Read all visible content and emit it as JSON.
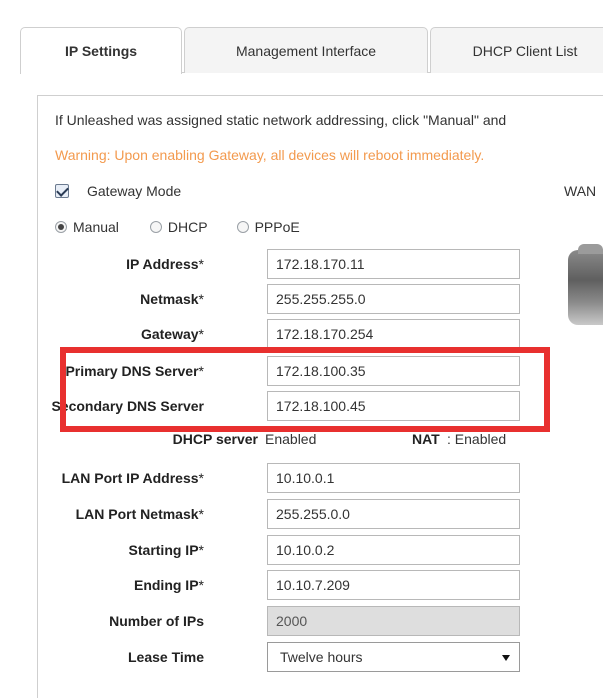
{
  "tabs": [
    {
      "label": "IP Settings",
      "active": true
    },
    {
      "label": "Management Interface",
      "active": false
    },
    {
      "label": "DHCP Client List",
      "active": false
    }
  ],
  "info_text": "If Unleashed was assigned static network addressing, click \"Manual\" and",
  "warning_text": "Warning: Upon enabling Gateway, all devices will reboot immediately.",
  "gateway_mode": {
    "label": "Gateway Mode",
    "checked": true
  },
  "wan_label": "WAN",
  "addressing_modes": {
    "options": [
      "Manual",
      "DHCP",
      "PPPoE"
    ],
    "selected": "Manual"
  },
  "fields": {
    "ip_address": {
      "label": "IP Address",
      "required": "*",
      "value": "172.18.170.11"
    },
    "netmask": {
      "label": "Netmask",
      "required": "*",
      "value": "255.255.255.0"
    },
    "gateway": {
      "label": "Gateway",
      "required": "*",
      "value": "172.18.170.254"
    },
    "primary_dns": {
      "label": "Primary DNS Server",
      "required": "*",
      "value": "172.18.100.35"
    },
    "secondary_dns": {
      "label": "Secondary DNS Server",
      "required": "",
      "value": "172.18.100.45"
    },
    "lan_ip": {
      "label": "LAN Port IP Address",
      "required": "*",
      "value": "10.10.0.1"
    },
    "lan_netmask": {
      "label": "LAN Port Netmask",
      "required": "*",
      "value": "255.255.0.0"
    },
    "starting_ip": {
      "label": "Starting IP",
      "required": "*",
      "value": "10.10.0.2"
    },
    "ending_ip": {
      "label": "Ending IP",
      "required": "*",
      "value": "10.10.7.209"
    },
    "number_of_ips": {
      "label": "Number of IPs",
      "value": "2000"
    },
    "lease_time": {
      "label": "Lease Time",
      "value": "Twelve hours"
    }
  },
  "dhcp_server": {
    "label": "DHCP server",
    "value": "Enabled"
  },
  "nat": {
    "label": "NAT",
    "value": ": Enabled"
  },
  "colors": {
    "warning": "#f39a4e",
    "highlight": "#e8302f"
  }
}
